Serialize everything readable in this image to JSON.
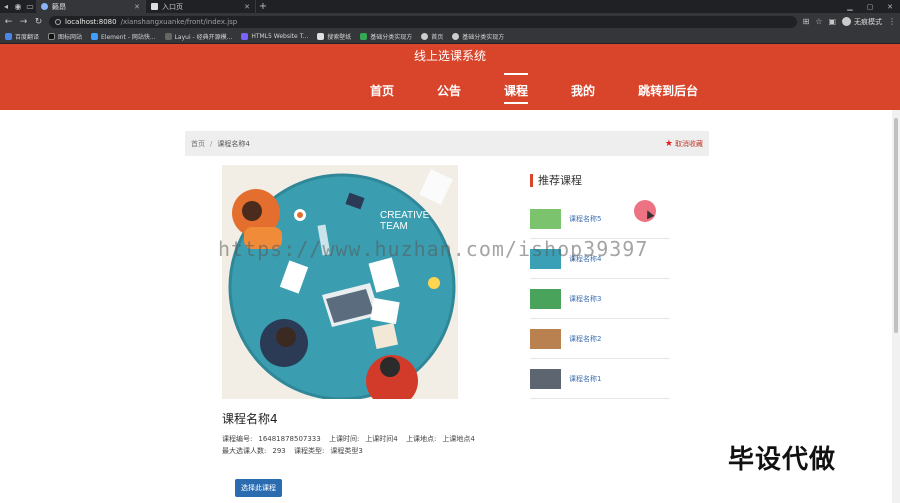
{
  "browser": {
    "tabs": [
      {
        "title": "籁昂",
        "active": true
      },
      {
        "title": "入口页",
        "active": false
      }
    ],
    "url_host": "localhost:8080",
    "url_path": "/xianshangxuanke/front/index.jsp",
    "profile_label": "无痕模式",
    "bookmarks": [
      "百度翻译",
      "图标网站",
      "Element - 网站快...",
      "Layui - 经典开源模...",
      "HTML5 Website T...",
      "搜索壁纸",
      "基础分类实现方",
      "首页",
      "基础分类实现方"
    ]
  },
  "site": {
    "title": "线上选课系统",
    "nav": [
      {
        "label": "首页",
        "active": false
      },
      {
        "label": "公告",
        "active": false
      },
      {
        "label": "课程",
        "active": true
      },
      {
        "label": "我的",
        "active": false
      },
      {
        "label": "跳转到后台",
        "active": false
      }
    ]
  },
  "breadcrumb": {
    "home": "首页",
    "separator": "/",
    "current": "课程名称4",
    "favorite_label": "取消收藏"
  },
  "poster": {
    "text_line1": "CREATIVE",
    "text_line2": "TEAM"
  },
  "recommend": {
    "title": "推荐课程",
    "items": [
      {
        "name": "课程名称5",
        "thumb": "#7cc36e"
      },
      {
        "name": "课程名称4",
        "thumb": "#3aa0b5"
      },
      {
        "name": "课程名称3",
        "thumb": "#4aa35a"
      },
      {
        "name": "课程名称2",
        "thumb": "#b8814f"
      },
      {
        "name": "课程名称1",
        "thumb": "#5d6670"
      }
    ]
  },
  "course": {
    "title": "课程名称4",
    "code_label": "课程编号:",
    "code_value": "16481878507333",
    "time_label": "上课时间:",
    "time_value": "上课时间4",
    "place_label": "上课地点:",
    "place_value": "上课地点4",
    "max_label": "最大选课人数:",
    "max_value": "293",
    "type_label": "课程类型:",
    "type_value": "课程类型3"
  },
  "select_button": "选择此课程",
  "watermark": "https://www.huzhan.com/ishop39397",
  "overlay_text": "毕设代做",
  "colors": {
    "header": "#d9452b",
    "button": "#2b6cb0",
    "link": "#3b6fb3"
  }
}
